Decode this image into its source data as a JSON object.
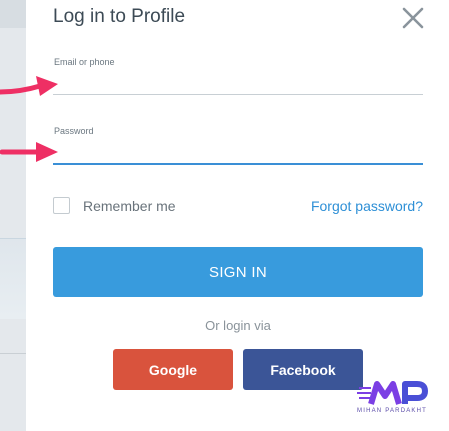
{
  "modal": {
    "title": "Log in to Profile",
    "close_icon": "close-icon"
  },
  "form": {
    "email": {
      "label": "Email or phone",
      "value": "",
      "placeholder": ""
    },
    "password": {
      "label": "Password",
      "value": "",
      "placeholder": ""
    },
    "remember_label": "Remember me",
    "remember_checked": false,
    "forgot_label": "Forgot password?",
    "signin_label": "SIGN IN",
    "or_label": "Or login via"
  },
  "social": {
    "google_label": "Google",
    "facebook_label": "Facebook"
  },
  "watermark": {
    "text": "MIHAN PARDAKHT"
  },
  "colors": {
    "accent": "#389bdd",
    "google": "#d9533d",
    "facebook": "#3b5597",
    "arrow": "#ee2f64",
    "link": "#2d8fd6"
  }
}
